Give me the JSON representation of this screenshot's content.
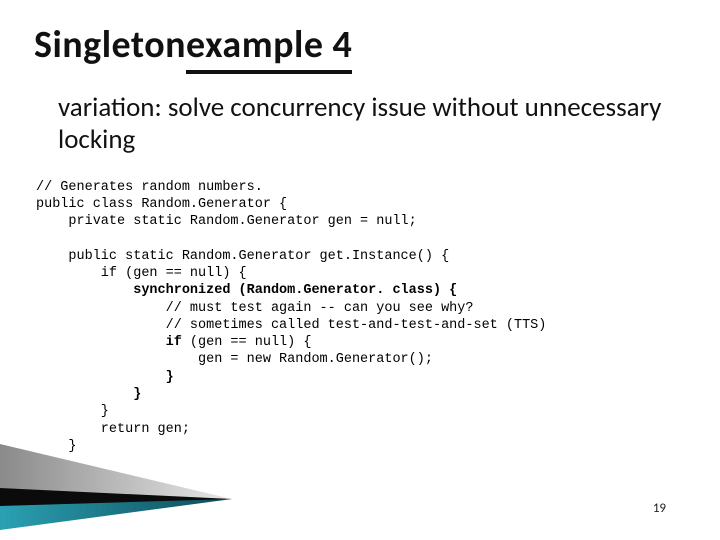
{
  "title": {
    "plain_part": "Singleton ",
    "underlined_part": "example 4"
  },
  "bullet": {
    "glyph": "",
    "text": "variation: solve concurrency issue without unnecessary locking"
  },
  "code": {
    "l01": "// Generates random numbers.",
    "l02": "public class Random.Generator {",
    "l03": "    private static Random.Generator gen = null;",
    "l04": "",
    "l05": "    public static Random.Generator get.Instance() {",
    "l06": "        if (gen == null) {",
    "l07a": "            ",
    "l07b": "synchronized (Random.Generator. class) {",
    "l08": "                // must test again -- can you see why?",
    "l09": "                // sometimes called test-and-test-and-set (TTS)",
    "l10a": "                ",
    "l10b": "if",
    "l10c": " (gen == null) {",
    "l11": "                    gen = new Random.Generator();",
    "l12a": "                ",
    "l12b": "}",
    "l13a": "            ",
    "l13b": "}",
    "l14": "        }",
    "l15": "        return gen;",
    "l16": "    }",
    "l17": "}"
  },
  "page_number": "19"
}
